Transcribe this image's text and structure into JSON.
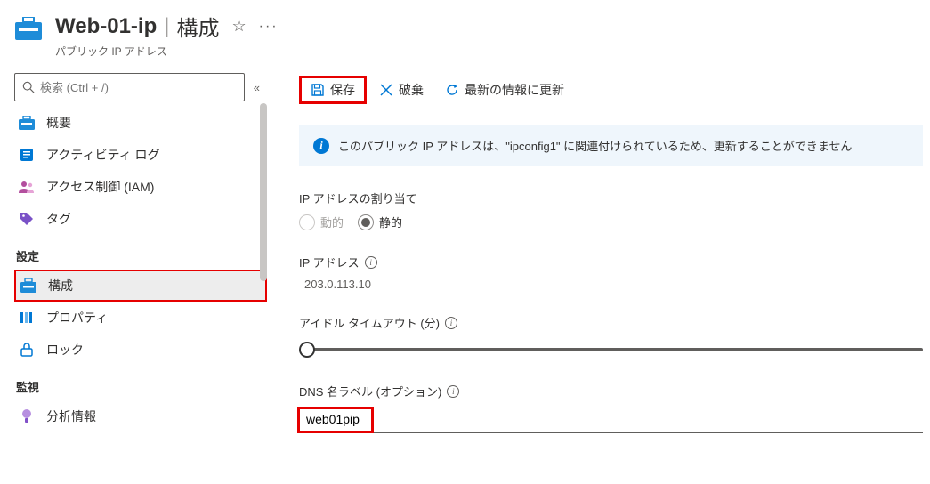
{
  "header": {
    "icon_name": "public-ip-icon",
    "title": "Web-01-ip",
    "section": "構成",
    "subtitle": "パブリック IP アドレス"
  },
  "sidebar": {
    "search_placeholder": "検索 (Ctrl + /)",
    "items_top": [
      {
        "id": "overview",
        "label": "概要",
        "icon": "public-ip-icon"
      },
      {
        "id": "activity-log",
        "label": "アクティビティ ログ",
        "icon": "activity-log-icon"
      },
      {
        "id": "iam",
        "label": "アクセス制御 (IAM)",
        "icon": "iam-icon"
      },
      {
        "id": "tags",
        "label": "タグ",
        "icon": "tag-icon"
      }
    ],
    "group_settings": "設定",
    "items_settings": [
      {
        "id": "configuration",
        "label": "構成",
        "icon": "public-ip-icon",
        "selected": true,
        "highlighted": true
      },
      {
        "id": "properties",
        "label": "プロパティ",
        "icon": "properties-icon"
      },
      {
        "id": "locks",
        "label": "ロック",
        "icon": "lock-icon"
      }
    ],
    "group_monitoring": "監視",
    "items_monitoring": [
      {
        "id": "insights",
        "label": "分析情報",
        "icon": "insights-icon"
      }
    ]
  },
  "toolbar": {
    "save": "保存",
    "discard": "破棄",
    "refresh": "最新の情報に更新"
  },
  "banner": {
    "text": "このパブリック IP アドレスは、\"ipconfig1\" に関連付けられているため、更新することができません"
  },
  "form": {
    "assignment_label": "IP アドレスの割り当て",
    "assignment_dynamic": "動的",
    "assignment_static": "静的",
    "ip_label": "IP アドレス",
    "ip_value": "203.0.113.10",
    "idle_label": "アイドル タイムアウト (分)",
    "dns_label": "DNS 名ラベル (オプション)",
    "dns_value": "web01pip"
  }
}
